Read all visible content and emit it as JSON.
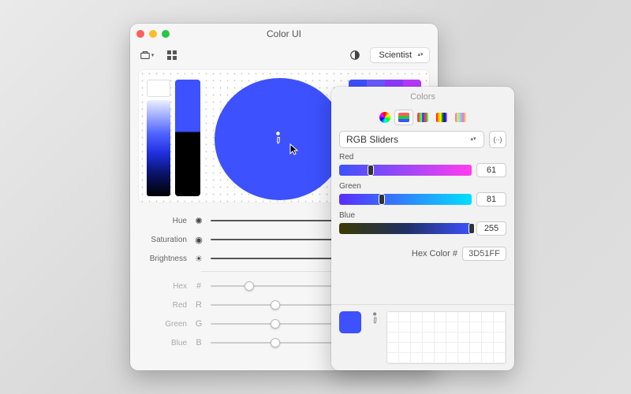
{
  "main": {
    "title": "Color UI",
    "theme_popup": "Scientist",
    "palette_colors": [
      "#3d51ff",
      "#6a5bff",
      "#8e3cff",
      "#b93aff"
    ],
    "sliders": [
      {
        "label": "Hue",
        "icon": "✺",
        "pos": 0.86,
        "dim": false
      },
      {
        "label": "Saturation",
        "icon": "◉",
        "pos": 0.86,
        "dim": false
      },
      {
        "label": "Brightness",
        "icon": "☀",
        "pos": 0.82,
        "dim": false
      },
      {
        "label": "Hex",
        "icon": "#",
        "pos": 0.18,
        "dim": true
      },
      {
        "label": "Red",
        "icon": "R",
        "pos": 0.3,
        "dim": true
      },
      {
        "label": "Green",
        "icon": "G",
        "pos": 0.3,
        "dim": true
      },
      {
        "label": "Blue",
        "icon": "B",
        "pos": 0.3,
        "dim": true
      }
    ]
  },
  "colors": {
    "title": "Colors",
    "mode": "RGB Sliders",
    "rgb": {
      "red": {
        "label": "Red",
        "value": "61",
        "pos": 0.24,
        "grad": "linear-gradient(90deg,#3d51ff,#ff3df0)"
      },
      "green": {
        "label": "Green",
        "value": "81",
        "pos": 0.32,
        "grad": "linear-gradient(90deg,#5a2cff,#00e0ff)"
      },
      "blue": {
        "label": "Blue",
        "value": "255",
        "pos": 1.0,
        "grad": "linear-gradient(90deg,#3a3a00,#203060,#3d51ff)"
      }
    },
    "hex_label": "Hex Color #",
    "hex_value": "3D51FF",
    "current_color": "#3d51ff"
  }
}
